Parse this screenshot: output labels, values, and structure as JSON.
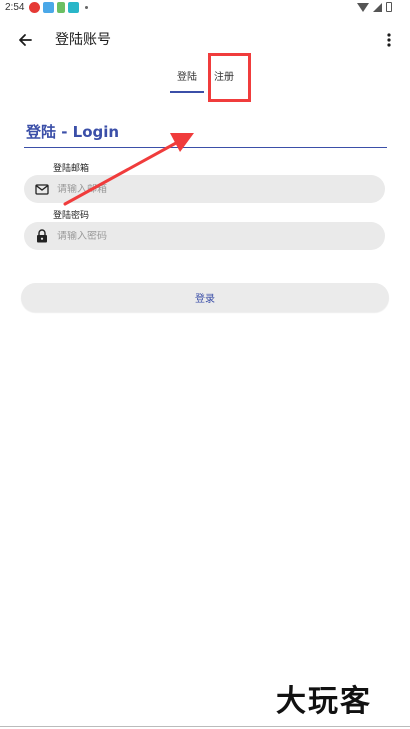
{
  "status_bar": {
    "time": "2:54"
  },
  "app_bar": {
    "title": "登陆账号",
    "back_icon": "arrow-left-icon",
    "more_icon": "more-vert-icon"
  },
  "tabs": [
    {
      "label": "登陆",
      "selected": true
    },
    {
      "label": "注册",
      "selected": false
    }
  ],
  "form": {
    "heading": "登陆 - Login",
    "email": {
      "label": "登陆邮箱",
      "placeholder": "请输入邮箱",
      "icon": "mail-icon"
    },
    "password": {
      "label": "登陆密码",
      "placeholder": "请输入密码",
      "icon": "lock-icon"
    },
    "submit_label": "登录"
  },
  "watermark": "大玩客",
  "colors": {
    "accent": "#3b4fa8",
    "annotation": "#f03c3c",
    "field_bg": "#eaeaea"
  }
}
